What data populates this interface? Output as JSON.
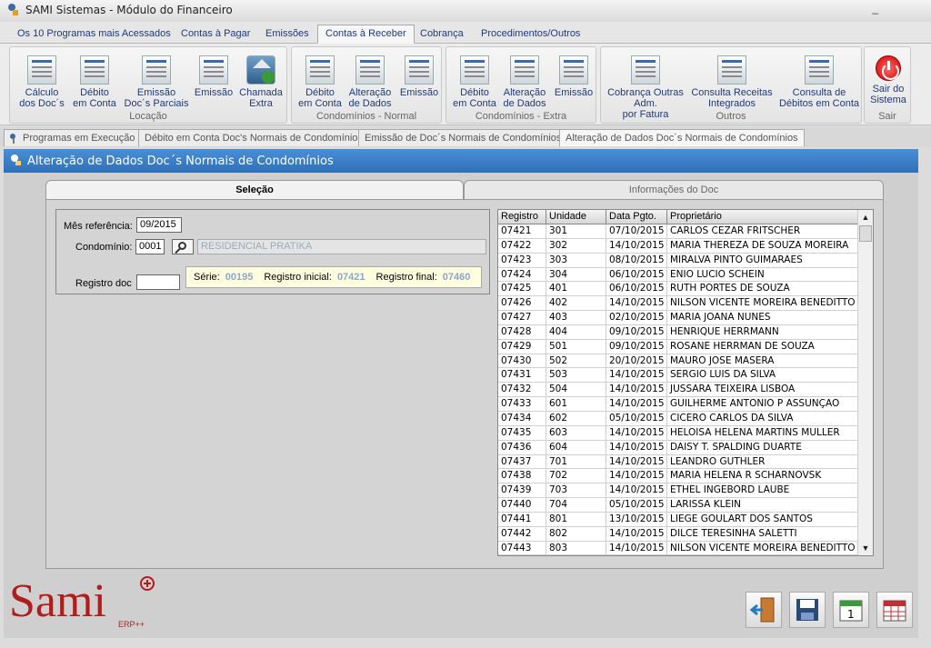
{
  "window": {
    "title": "SAMI Sistemas - Módulo do Financeiro",
    "minimize": "_"
  },
  "menu_tabs": [
    "Os 10 Programas mais Acessados",
    "Contas à Pagar",
    "Emissões",
    "Contas à Receber",
    "Cobrança",
    "Procedimentos/Outros"
  ],
  "active_menu": "Contas à Receber",
  "ribbon": {
    "groups": [
      {
        "label": "Locação",
        "buttons": [
          "Cálculo\ndos Doc´s",
          "Débito\nem Conta",
          "Emissão\nDoc´s Parciais",
          "Emissão",
          "Chamada\nExtra"
        ]
      },
      {
        "label": "Condomínios - Normal",
        "buttons": [
          "Débito\nem Conta",
          "Alteração\nde Dados",
          "Emissão"
        ]
      },
      {
        "label": "Condomínios - Extra",
        "buttons": [
          "Débito\nem Conta",
          "Alteração\nde Dados",
          "Emissão"
        ]
      },
      {
        "label": "Outros",
        "buttons": [
          "Cobrança Outras\nAdm.\npor Fatura",
          "Consulta Receitas\nIntegrados",
          "Consulta de\nDébitos em Conta"
        ]
      },
      {
        "label": "Sair",
        "buttons": [
          "Sair do\nSistema"
        ]
      }
    ]
  },
  "doc_tabs": [
    "Programas em Execução",
    "Débito em Conta Doc's Normais de Condomínios",
    "Emissão de Doc´s Normais de Condomínios",
    "Alteração de Dados Doc´s Normais de Condomínios"
  ],
  "panel_title": "Alteração de Dados Doc´s Normais de Condomínios",
  "card_tabs": {
    "selecao": "Seleção",
    "info": "Informações do Doc"
  },
  "form": {
    "mes_label": "Mês referência:",
    "mes_value": "09/2015",
    "cond_label": "Condomínio:",
    "cond_code": "0001",
    "cond_name": "RESIDENCIAL PRATIKA",
    "registro_label": "Registro doc",
    "registro_value": "",
    "serie_label": "Série:",
    "serie_value": "00195",
    "reg_ini_label": "Registro inicial:",
    "reg_ini_value": "07421",
    "reg_fim_label": "Registro final:",
    "reg_fim_value": "07460"
  },
  "grid": {
    "columns": [
      "Registro",
      "Unidade",
      "Data Pgto.",
      "Proprietário"
    ],
    "rows": [
      [
        "07421",
        "301",
        "07/10/2015",
        "CARLOS CEZAR FRITSCHER"
      ],
      [
        "07422",
        "302",
        "14/10/2015",
        "MARIA THEREZA DE SOUZA MOREIRA"
      ],
      [
        "07423",
        "303",
        "08/10/2015",
        "MIRALVA PINTO GUIMARAES"
      ],
      [
        "07424",
        "304",
        "06/10/2015",
        "ENIO LUCIO SCHEIN"
      ],
      [
        "07425",
        "401",
        "06/10/2015",
        "RUTH PORTES DE SOUZA"
      ],
      [
        "07426",
        "402",
        "14/10/2015",
        "NILSON VICENTE MOREIRA BENEDITTO"
      ],
      [
        "07427",
        "403",
        "02/10/2015",
        "MARIA JOANA NUNES"
      ],
      [
        "07428",
        "404",
        "09/10/2015",
        "HENRIQUE HERRMANN"
      ],
      [
        "07429",
        "501",
        "09/10/2015",
        "ROSANE HERRMAN DE SOUZA"
      ],
      [
        "07430",
        "502",
        "20/10/2015",
        "MAURO JOSE MASERA"
      ],
      [
        "07431",
        "503",
        "14/10/2015",
        "SERGIO LUIS DA SILVA"
      ],
      [
        "07432",
        "504",
        "14/10/2015",
        "JUSSARA TEIXEIRA LISBOA"
      ],
      [
        "07433",
        "601",
        "14/10/2015",
        "GUILHERME ANTONIO P ASSUNÇAO"
      ],
      [
        "07434",
        "602",
        "05/10/2015",
        "CICERO CARLOS DA SILVA"
      ],
      [
        "07435",
        "603",
        "14/10/2015",
        "HELOISA HELENA MARTINS MULLER"
      ],
      [
        "07436",
        "604",
        "14/10/2015",
        "DAISY T. SPALDING DUARTE"
      ],
      [
        "07437",
        "701",
        "14/10/2015",
        "LEANDRO GUTHLER"
      ],
      [
        "07438",
        "702",
        "14/10/2015",
        "MARIA HELENA R SCHARNOVSK"
      ],
      [
        "07439",
        "703",
        "14/10/2015",
        "ETHEL INGEBORD LAUBE"
      ],
      [
        "07440",
        "704",
        "05/10/2015",
        "LARISSA KLEIN"
      ],
      [
        "07441",
        "801",
        "13/10/2015",
        "LIEGE GOULART DOS SANTOS"
      ],
      [
        "07442",
        "802",
        "14/10/2015",
        "DILCE TERESINHA SALETTI"
      ],
      [
        "07443",
        "803",
        "14/10/2015",
        "NILSON VICENTE MOREIRA BENEDITTO"
      ]
    ]
  },
  "logo": {
    "brand": "Sami",
    "sub": "ERP++"
  },
  "colors": {
    "accent": "#2e6fb8",
    "link": "#1f3a7a",
    "logo": "#b21c1c"
  },
  "bottom_icons": [
    "exit-door-icon",
    "save-disk-icon",
    "calendar-icon",
    "calendar-grid-icon"
  ]
}
